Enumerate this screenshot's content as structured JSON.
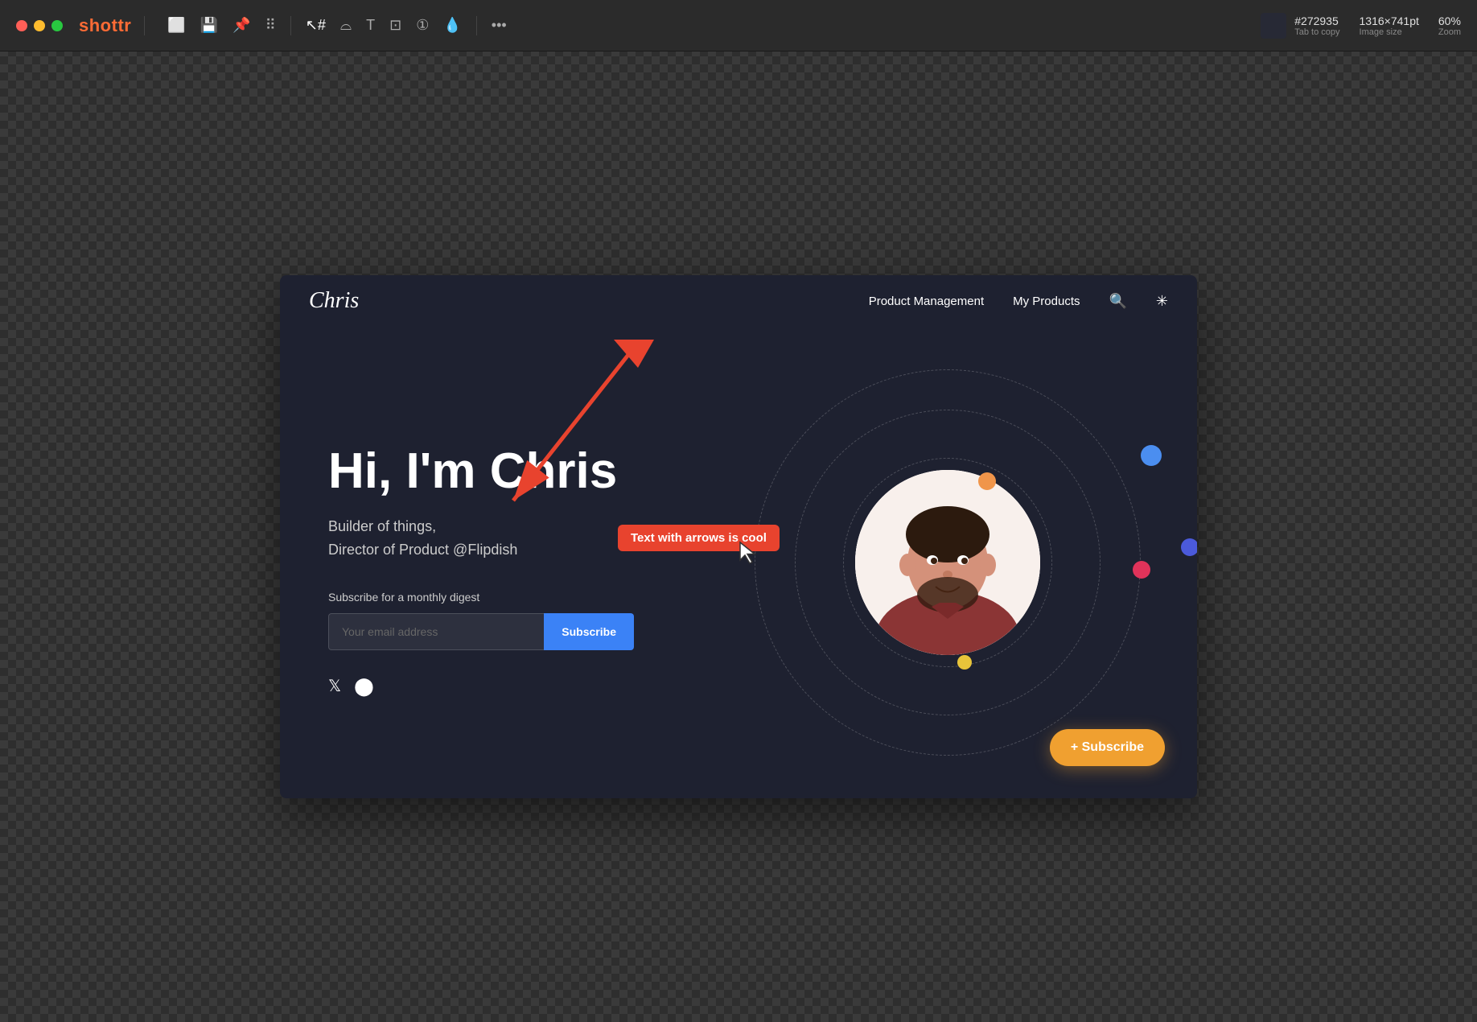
{
  "app": {
    "name": "shottr",
    "title": "shottr"
  },
  "topbar": {
    "color_hex": "#272935",
    "tab_to_copy": "Tab to copy",
    "image_size": "1316×741pt",
    "image_size_label": "Image size",
    "zoom": "60%",
    "zoom_label": "Zoom"
  },
  "toolbar": {
    "icons": [
      "copy",
      "save",
      "pin",
      "grid",
      "cursor-plus",
      "lasso",
      "text",
      "crop",
      "circle-1",
      "drop",
      "more"
    ]
  },
  "website": {
    "logo": "Chris",
    "nav": {
      "links": [
        "Product Management",
        "My Products"
      ],
      "icons": [
        "search",
        "brightness"
      ]
    },
    "hero": {
      "heading": "Hi, I'm Chris",
      "subtitle_line1": "Builder of things,",
      "subtitle_line2": "Director of Product @Flipdish",
      "subscribe_label": "Subscribe for a monthly digest",
      "email_placeholder": "Your email address",
      "subscribe_button": "Subscribe"
    },
    "annotation": {
      "tooltip": "Text with arrows is cool"
    },
    "floating_subscribe": {
      "label": "+ Subscribe"
    },
    "social": {
      "icons": [
        "twitter",
        "github"
      ]
    }
  }
}
